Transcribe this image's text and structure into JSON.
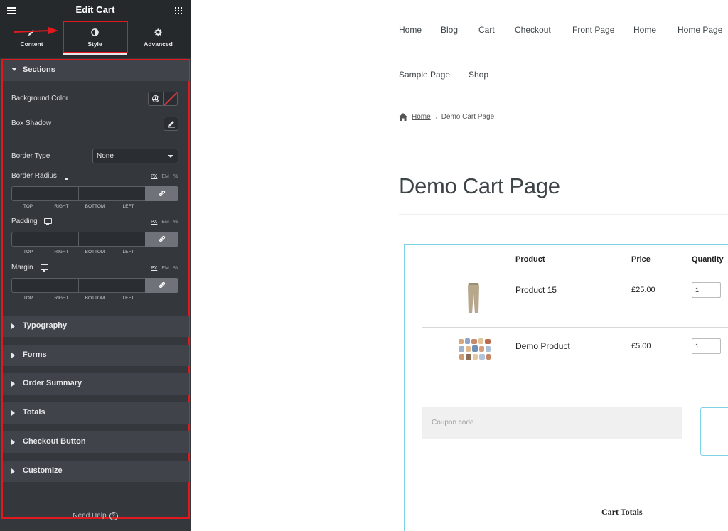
{
  "panel": {
    "title": "Edit Cart",
    "tabs": [
      {
        "label": "Content",
        "icon": "pencil-icon"
      },
      {
        "label": "Style",
        "icon": "contrast-icon",
        "active": true
      },
      {
        "label": "Advanced",
        "icon": "gear-icon"
      }
    ],
    "sections": {
      "label": "Sections",
      "background_color": "Background Color",
      "box_shadow": "Box Shadow",
      "border_type": "Border Type",
      "border_type_value": "None",
      "border_radius": "Border Radius",
      "padding": "Padding",
      "margin": "Margin",
      "units": [
        "PX",
        "EM",
        "%"
      ],
      "dim_labels": [
        "TOP",
        "RIGHT",
        "BOTTOM",
        "LEFT"
      ]
    },
    "collapsed_sections": [
      "Typography",
      "Forms",
      "Order Summary",
      "Totals",
      "Checkout Button",
      "Customize"
    ],
    "need_help": "Need Help",
    "accent_highlight": "#e0191f"
  },
  "site": {
    "nav": [
      "Home",
      "Blog",
      "Cart",
      "Checkout",
      "Front Page",
      "Home",
      "Home Page",
      "Sample Page",
      "Shop"
    ],
    "breadcrumb": {
      "home": "Home",
      "current": "Demo Cart Page"
    },
    "page_title": "Demo Cart Page",
    "cart": {
      "headers": [
        "Product",
        "Price",
        "Quantity"
      ],
      "rows": [
        {
          "name": "Product 15",
          "price": "£25.00",
          "qty": "1"
        },
        {
          "name": "Demo Product",
          "price": "£5.00",
          "qty": "1"
        }
      ],
      "coupon_placeholder": "Coupon code",
      "totals_heading": "Cart Totals"
    },
    "widget_border_color": "#7ed3e4"
  }
}
